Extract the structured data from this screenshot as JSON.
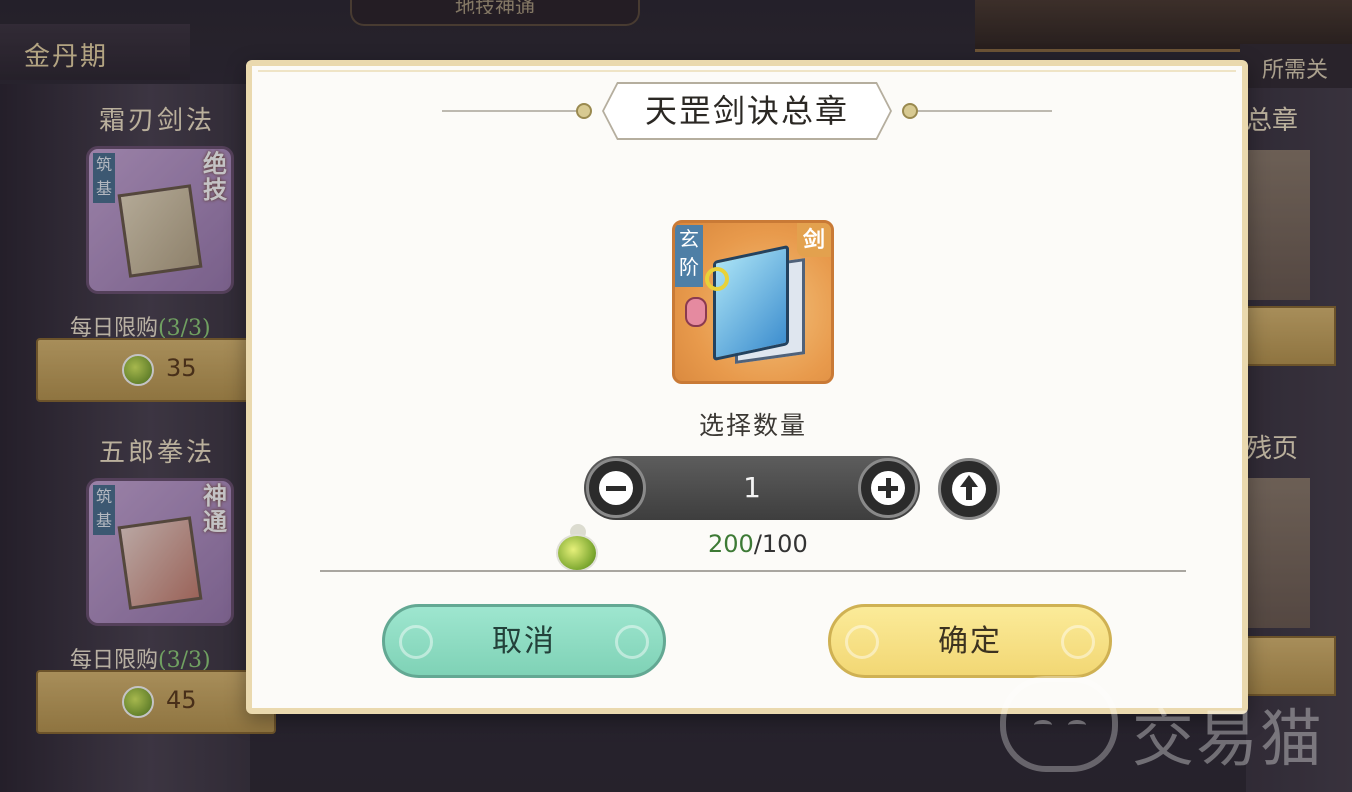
{
  "background": {
    "top_banner_text": "地技神通",
    "realm_label": "金丹期",
    "required_hint": "所需关系",
    "right_header": "所需关",
    "left_items": [
      {
        "name": "霜刃剑法",
        "tier": "筑基",
        "grade": "绝技",
        "limit_prefix": "每日限购",
        "limit_count": "(3/3)",
        "price": "35"
      },
      {
        "name": "五郎拳法",
        "tier": "筑基",
        "grade": "神通",
        "limit_prefix": "每日限购",
        "limit_count": "(3/3)",
        "price": "45"
      }
    ],
    "right_items": [
      {
        "name_fragment": "总章"
      },
      {
        "name_fragment": "残页"
      }
    ]
  },
  "dialog": {
    "title": "天罡剑诀总章",
    "item": {
      "tier": "玄阶",
      "type": "剑",
      "icon": "sword-manual-icon"
    },
    "quantity_label": "选择数量",
    "quantity": "1",
    "cost": {
      "owned": "200",
      "separator": "/",
      "required": "100",
      "currency_icon": "spirit-stone-icon"
    },
    "cancel_label": "取消",
    "confirm_label": "确定"
  },
  "watermark": {
    "text": "交易猫"
  },
  "colors": {
    "cancel_button": "#8fdcc3",
    "confirm_button": "#f6e084",
    "owned_amount": "#3d7a35",
    "stepper_bg": "#4e4e4e",
    "modal_border": "#ead9ae"
  }
}
